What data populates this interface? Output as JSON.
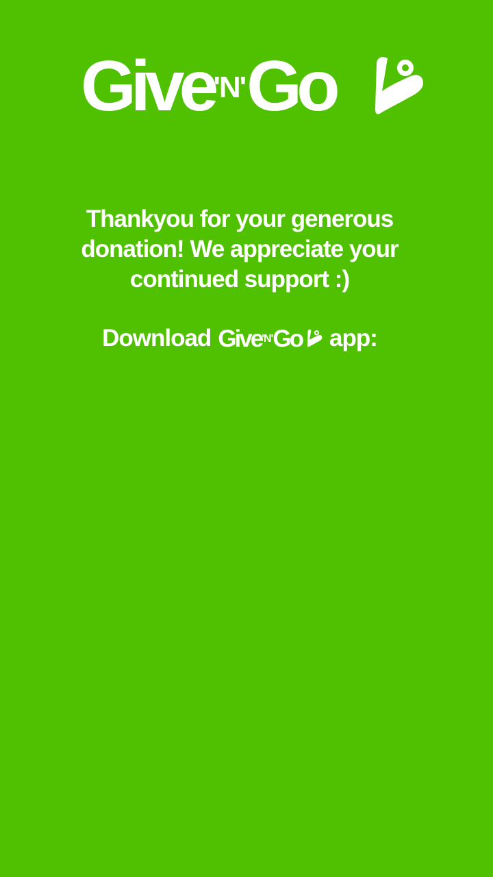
{
  "brand": {
    "name_part1": "Give",
    "name_part2": "'N'",
    "name_part3": "Go",
    "logo_icon": "givengo-person-icon",
    "background_color": "#4fc100",
    "text_color": "#ffffff"
  },
  "message": {
    "thank_you": "Thankyou for your generous donation! We appreciate your continued support :)"
  },
  "download": {
    "prefix": "Download",
    "suffix": "app:"
  }
}
